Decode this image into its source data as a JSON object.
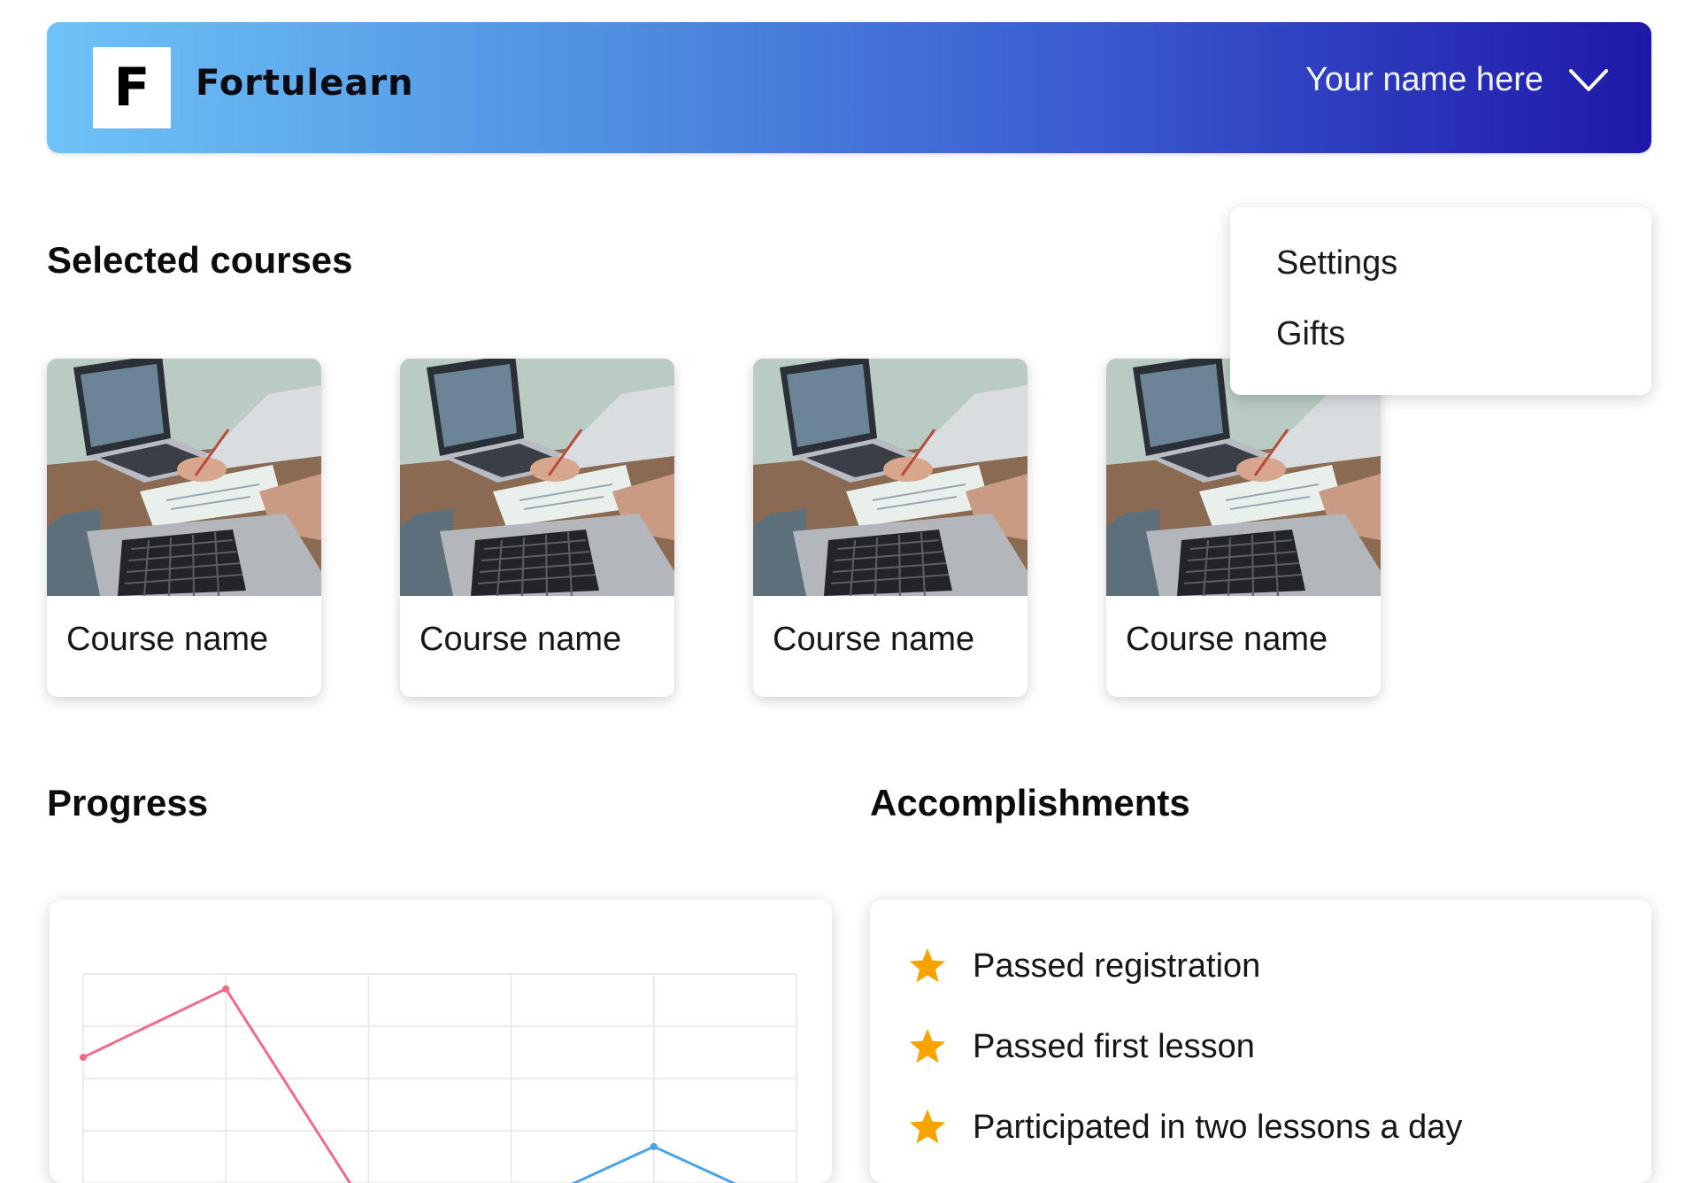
{
  "header": {
    "logo_letter": "F",
    "brand_name": "Fortulearn",
    "user_name": "Your name here",
    "user_menu_icon": "chevron-down-icon"
  },
  "user_dropdown": {
    "items": [
      {
        "label": "Settings"
      },
      {
        "label": "Gifts"
      }
    ]
  },
  "selected_courses": {
    "title": "Selected courses",
    "courses": [
      {
        "name": "Course name",
        "image": "laptop-desk-photo"
      },
      {
        "name": "Course name",
        "image": "laptop-desk-photo"
      },
      {
        "name": "Course name",
        "image": "laptop-desk-photo"
      },
      {
        "name": "Course name",
        "image": "laptop-desk-photo"
      }
    ]
  },
  "progress": {
    "title": "Progress"
  },
  "accomplishments": {
    "title": "Accomplishments",
    "star_color": "#f7a400",
    "items": [
      {
        "label": "Passed registration",
        "icon": "star-icon"
      },
      {
        "label": "Passed first lesson",
        "icon": "star-icon"
      },
      {
        "label": "Participated in two lessons a day",
        "icon": "star-icon"
      }
    ]
  },
  "chart_data": {
    "type": "line",
    "title": "",
    "xlabel": "",
    "ylabel": "",
    "grid": true,
    "legend": "none",
    "series": [
      {
        "color": "#f06b8a",
        "values": [
          0.72,
          0.95,
          0.2,
          null,
          null,
          0.2
        ]
      },
      {
        "color": "#4aa3e8",
        "values": [
          null,
          null,
          null,
          0.2,
          0.42,
          0.2
        ]
      }
    ]
  }
}
